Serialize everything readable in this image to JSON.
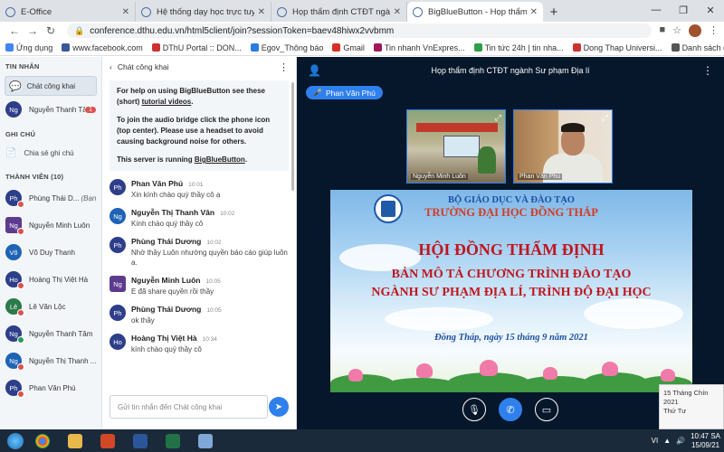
{
  "browser": {
    "tabs": [
      {
        "label": "E-Office",
        "active": false
      },
      {
        "label": "Hệ thống dạy học trực tuyến Đạ",
        "active": false
      },
      {
        "label": "Họp thẩm định CTĐT ngành Sư p",
        "active": false
      },
      {
        "label": "BigBlueButton - Họp thẩm đ",
        "active": true
      }
    ],
    "url": "conference.dthu.edu.vn/html5client/join?sessionToken=baev48hiwx2vvbmm",
    "bookmarks": [
      {
        "label": "Ứng dụng",
        "color": "#4285f4"
      },
      {
        "label": "www.facebook.com",
        "color": "#3b5998"
      },
      {
        "label": "DThU Portal :: DON...",
        "color": "#cc3333"
      },
      {
        "label": "Egov_Thông báo",
        "color": "#2a7de1"
      },
      {
        "label": "Gmail",
        "color": "#d93025"
      },
      {
        "label": "Tin nhanh VnExpres...",
        "color": "#a0185a"
      },
      {
        "label": "Tin tức 24h | tin nha...",
        "color": "#2f9e44"
      },
      {
        "label": "Dong Thap Universi...",
        "color": "#cc3333"
      },
      {
        "label": "Danh sách đọc",
        "color": "#555555"
      }
    ]
  },
  "sidebar": {
    "messages_header": "TIN NHẮN",
    "public_chat": "Chát công khai",
    "private_chats": [
      {
        "initials": "Ng",
        "name": "Nguyễn Thanh Tâm",
        "unread": "1",
        "color": "#2d3e8a"
      }
    ],
    "notes_header": "GHI CHÚ",
    "shared_notes": "Chia sẻ ghi chú",
    "members_header": "THÀNH VIÊN (10)",
    "members": [
      {
        "initials": "Ph",
        "name": "Phùng Thái D...",
        "you": "(Bạn)",
        "color": "#2d3e8a",
        "square": false
      },
      {
        "initials": "Ng",
        "name": "Nguyễn Minh Luôn",
        "you": "",
        "color": "#5c3b8f",
        "square": true
      },
      {
        "initials": "Võ",
        "name": "Võ Duy Thanh",
        "you": "",
        "color": "#1e63b5",
        "square": false
      },
      {
        "initials": "Ho",
        "name": "Hoàng Thị Việt Hà",
        "you": "",
        "color": "#2d3e8a",
        "square": false
      },
      {
        "initials": "Lê",
        "name": "Lê Văn Lộc",
        "you": "",
        "color": "#2a7a4b",
        "square": false
      },
      {
        "initials": "Ng",
        "name": "Nguyễn Thanh Tâm",
        "you": "",
        "color": "#2d3e8a",
        "square": false
      },
      {
        "initials": "Ng",
        "name": "Nguyễn Thị Thanh ...",
        "you": "",
        "color": "#1e63b5",
        "square": false
      },
      {
        "initials": "Ph",
        "name": "Phan Văn Phú",
        "you": "",
        "color": "#2d3e8a",
        "square": false
      }
    ]
  },
  "chat": {
    "title": "Chát công khai",
    "welcome": {
      "help_prefix": "For help on using BigBlueButton see these (short) ",
      "help_link": "tutorial videos",
      "help_suffix": ".",
      "audio": "To join the audio bridge click the phone icon (top center). Please use a headset to avoid causing background noise for others.",
      "running_prefix": "This server is running ",
      "running_link": "BigBlueButton",
      "running_suffix": "."
    },
    "messages": [
      {
        "initials": "Ph",
        "name": "Phan Văn Phú",
        "time": "10:01",
        "text": "Xin kính chào quý thầy cô ạ",
        "color": "#2d3e8a",
        "square": false
      },
      {
        "initials": "Ng",
        "name": "Nguyễn Thị Thanh Vân",
        "time": "10:02",
        "text": "Kính chào quý thầy cô",
        "color": "#1e63b5",
        "square": false
      },
      {
        "initials": "Ph",
        "name": "Phùng Thái Dương",
        "time": "10:02",
        "text": "Nhờ thầy Luôn nhường quyền báo cáo giúp luôn a.",
        "color": "#2d3e8a",
        "square": false
      },
      {
        "initials": "Ng",
        "name": "Nguyễn Minh Luôn",
        "time": "10:05",
        "text": "E đã share quyền rồi thầy",
        "color": "#5c3b8f",
        "square": true
      },
      {
        "initials": "Ph",
        "name": "Phùng Thái Dương",
        "time": "10:05",
        "text": "ok thầy",
        "color": "#2d3e8a",
        "square": false
      },
      {
        "initials": "Ho",
        "name": "Hoàng Thị Việt Hà",
        "time": "10:34",
        "text": "kính chào quý thầy cô",
        "color": "#2d3e8a",
        "square": false
      }
    ],
    "input_placeholder": "Gửi tin nhắn đến Chát công khai"
  },
  "main": {
    "meeting_title": "Họp thẩm định CTĐT ngành Sư phạm Địa lí",
    "talking": "Phan Văn Phú",
    "cameras": [
      {
        "name": "Nguyễn Minh Luôn"
      },
      {
        "name": "Phan Văn Phú"
      }
    ],
    "slide": {
      "line1": "BỘ GIÁO DỤC VÀ ĐÀO TẠO",
      "line2": "TRƯỜNG ĐẠI HỌC ĐỒNG THÁP",
      "line3": "HỘI ĐỒNG THẨM ĐỊNH",
      "line4": "BẢN MÔ TẢ CHƯƠNG TRÌNH ĐÀO TẠO",
      "line5": "NGÀNH SƯ PHẠM ĐỊA LÍ, TRÌNH ĐỘ ĐẠI HỌC",
      "date": "Đồng Tháp, ngày 15 tháng 9 năm 2021"
    },
    "tooltip_date": "15 Tháng Chín 2021",
    "tooltip_day": "Thứ Tư"
  },
  "taskbar": {
    "time": "10:47 SA",
    "date": "15/09/21",
    "lang": "VI"
  }
}
